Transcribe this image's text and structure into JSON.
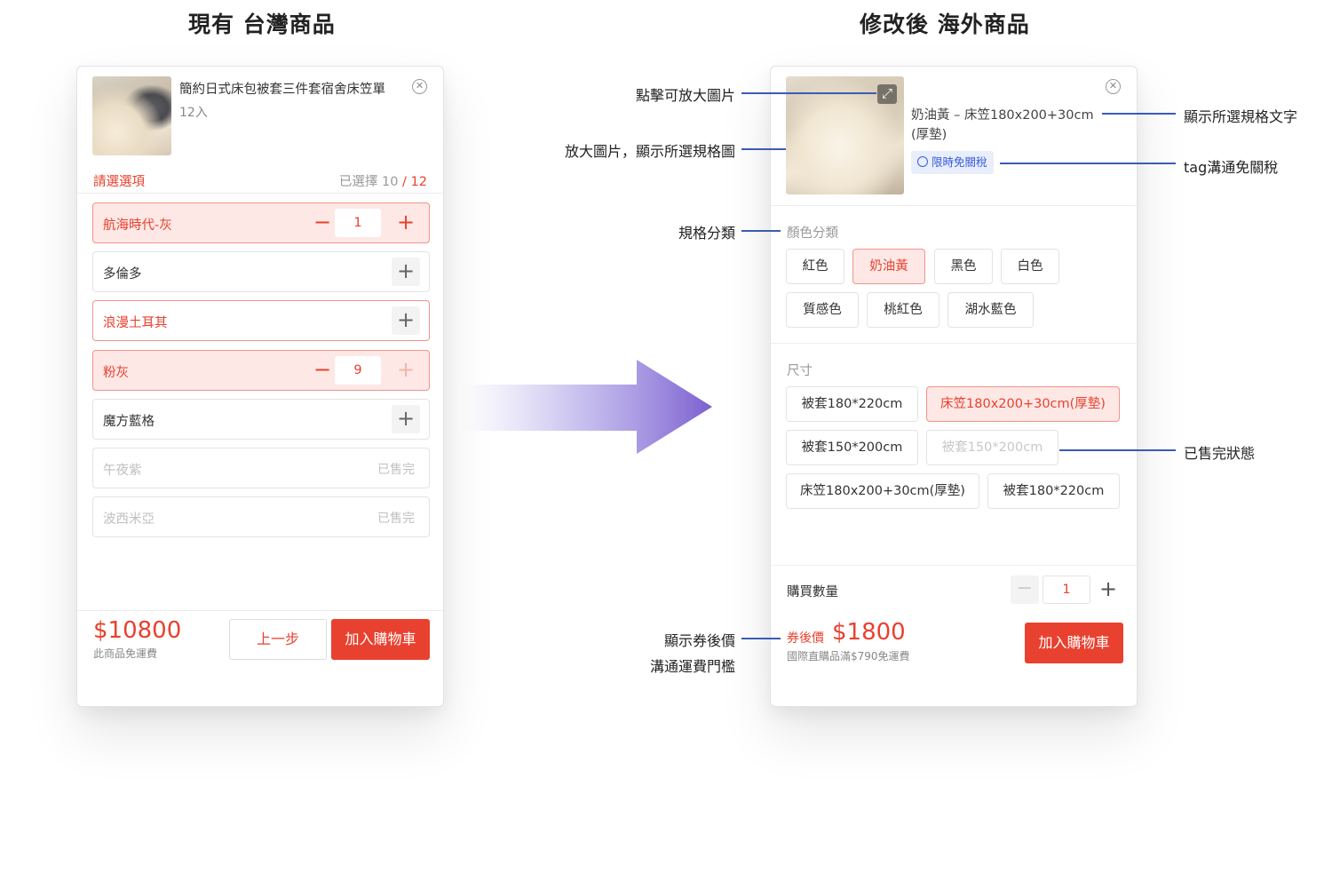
{
  "headings": {
    "left": "現有 台灣商品",
    "right": "修改後 海外商品"
  },
  "left_panel": {
    "product_title": "簡約日式床包被套三件套宿舍床笠單",
    "product_sub": "12入",
    "choose_label": "請選選項",
    "selected_prefix": "已選擇 10",
    "selected_sep": " / ",
    "selected_total": "12",
    "options": [
      {
        "name": "航海時代-灰",
        "qty": "1"
      },
      {
        "name": "多倫多"
      },
      {
        "name": "浪漫土耳其"
      },
      {
        "name": "粉灰",
        "qty": "9"
      },
      {
        "name": "魔方藍格"
      },
      {
        "name": "午夜紫",
        "status": "已售完"
      },
      {
        "name": "波西米亞",
        "status": "已售完"
      }
    ],
    "price": "$10800",
    "shipping": "此商品免運費",
    "prev_button": "上一步",
    "cart_button": "加入購物車"
  },
  "right_panel": {
    "spec_text": "奶油黃 – 床笠180x200+30cm (厚墊)",
    "tag": "限時免關稅",
    "color_section": "顏色分類",
    "colors": [
      "紅色",
      "奶油黃",
      "黑色",
      "白色",
      "質感色",
      "桃紅色",
      "湖水藍色"
    ],
    "size_section": "尺寸",
    "sizes": [
      "被套180*220cm",
      "床笠180x200+30cm(厚墊)",
      "被套150*200cm",
      "被套150*200cm",
      "床笠180x200+30cm(厚墊)",
      "被套180*220cm"
    ],
    "qty_label": "購買數量",
    "qty": "1",
    "price_label": "券後價",
    "price": "$1800",
    "shipping": "國際直購品滿$790免運費",
    "cart_button": "加入購物車"
  },
  "annotations": {
    "zoom": "點擊可放大圖片",
    "enlarge": "放大圖片，顯示所選規格圖",
    "category": "規格分類",
    "coupon_line1": "顯示券後價",
    "coupon_line2": "溝通運費門檻",
    "spec_text": "顯示所選規格文字",
    "tag": "tag溝通免關稅",
    "soldout": "已售完狀態"
  },
  "colors": {
    "accent": "#e8412f",
    "selected_bg": "#fde8e5",
    "annotation_line": "#3b5bb6",
    "tag_blue": "#3a5bd9"
  }
}
